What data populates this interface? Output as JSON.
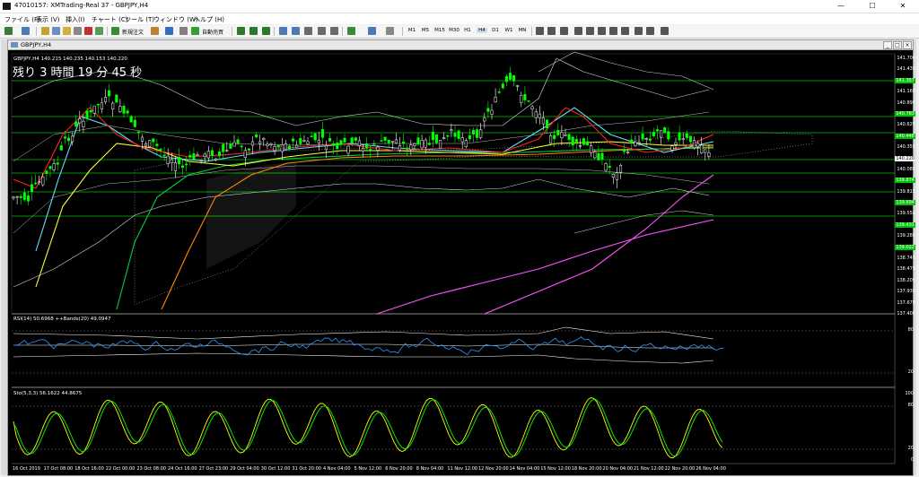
{
  "window": {
    "title": "47010157: XMTrading-Real 37 - GBPJPY,H4",
    "minimize": "—",
    "maximize": "☐",
    "close": "✕"
  },
  "menu": [
    "ファイル (F)",
    "表示 (V)",
    "挿入(I)",
    "チャート (C)",
    "ツール (T)",
    "ウィンドウ (W)",
    "ヘルプ (H)"
  ],
  "toolbar": {
    "new_order": "新規注文",
    "auto_trade": "自動売買",
    "timeframes": [
      "M1",
      "M5",
      "M15",
      "M30",
      "H1",
      "H4",
      "D1",
      "W1",
      "MN"
    ]
  },
  "chart": {
    "window_title": "GBPJPY,H4",
    "symbol_line": "GBPJPY,H4 140.215 140.235 140.153 140.220",
    "timer": "残り 3 時間 19 分 45 秒",
    "price_labels": [
      {
        "text": "141.700",
        "style": "plain"
      },
      {
        "text": "141.435",
        "style": "plain"
      },
      {
        "text": "141.357",
        "style": "green"
      },
      {
        "text": "141.165",
        "style": "plain"
      },
      {
        "text": "140.895",
        "style": "plain"
      },
      {
        "text": "140.783",
        "style": "green"
      },
      {
        "text": "140.625",
        "style": "plain"
      },
      {
        "text": "140.448",
        "style": "green"
      },
      {
        "text": "140.355",
        "style": "plain"
      },
      {
        "text": "140.220",
        "style": "white"
      },
      {
        "text": "140.085",
        "style": "plain"
      },
      {
        "text": "139.874",
        "style": "green"
      },
      {
        "text": "139.815",
        "style": "plain"
      },
      {
        "text": "139.694",
        "style": "green"
      },
      {
        "text": "139.550",
        "style": "plain"
      },
      {
        "text": "139.431",
        "style": "green"
      },
      {
        "text": "139.280",
        "style": "plain"
      },
      {
        "text": "139.022",
        "style": "green"
      },
      {
        "text": "138.745",
        "style": "plain"
      },
      {
        "text": "138.475",
        "style": "plain"
      },
      {
        "text": "138.205",
        "style": "plain"
      },
      {
        "text": "137.935",
        "style": "plain"
      },
      {
        "text": "137.670",
        "style": "plain"
      },
      {
        "text": "137.400",
        "style": "plain"
      }
    ],
    "date_labels": [
      "16 Oct 2019",
      "17 Oct 08:00",
      "18 Oct 16:00",
      "22 Oct 00:00",
      "23 Oct 08:00",
      "24 Oct 16:00",
      "27 Oct 23:00",
      "29 Oct 04:00",
      "30 Oct 12:00",
      "31 Oct 20:00",
      "4 Nov 04:00",
      "5 Nov 12:00",
      "6 Nov 20:00",
      "8 Nov 04:00",
      "11 Nov 12:00",
      "12 Nov 20:00",
      "14 Nov 04:00",
      "15 Nov 12:00",
      "18 Nov 20:00",
      "20 Nov 04:00",
      "21 Nov 12:00",
      "22 Nov 20:00",
      "26 Nov 04:00"
    ]
  },
  "rsi": {
    "label": "RSI(14) 50.6968  ++Bands(20) 49.0947",
    "levels": [
      "80",
      "20"
    ]
  },
  "stoch": {
    "label": "Sto(5,3,3) 56.1622 44.8675",
    "levels": [
      "100",
      "80",
      "20",
      "0"
    ]
  },
  "colors": {
    "bull_candle": "#00ff00",
    "bear_candle": "#ffffff",
    "sr_line": "#00c400",
    "sma_long": "#ff55ff",
    "rsi_line": "#3399ff",
    "stoch_main": "#ffff00",
    "stoch_signal": "#00ff00"
  }
}
